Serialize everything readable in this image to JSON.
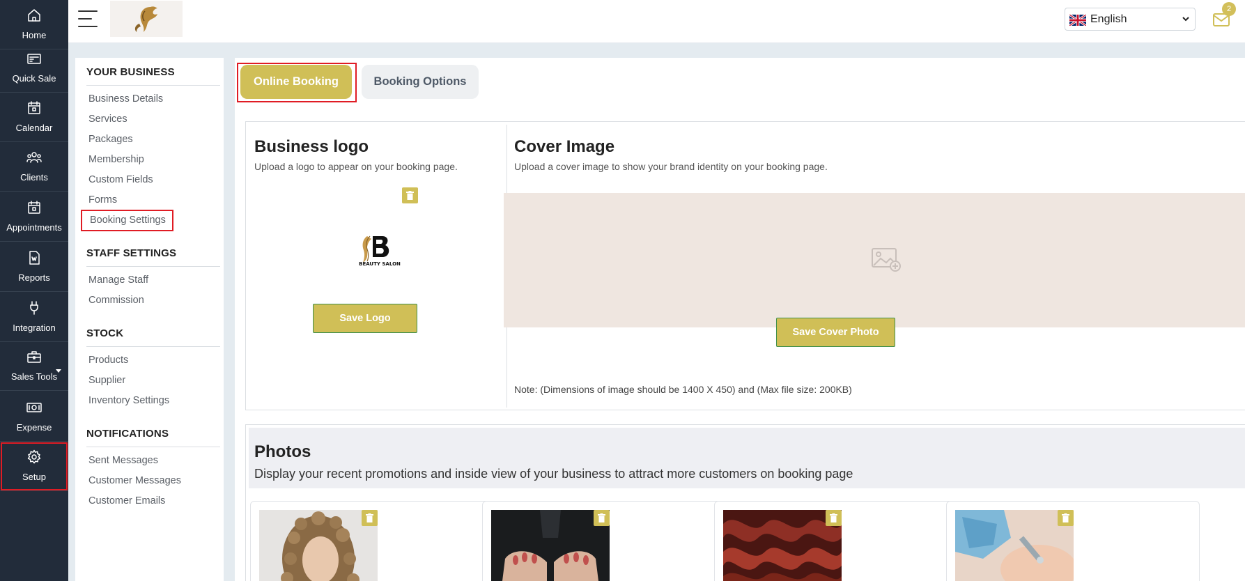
{
  "nav": {
    "items": [
      {
        "label": "Home",
        "icon": "home-icon"
      },
      {
        "label": "Quick Sale",
        "icon": "receipt-icon"
      },
      {
        "label": "Calendar",
        "icon": "calendar-icon"
      },
      {
        "label": "Clients",
        "icon": "users-icon"
      },
      {
        "label": "Appointments",
        "icon": "calendar-check-icon"
      },
      {
        "label": "Reports",
        "icon": "report-icon"
      },
      {
        "label": "Integration",
        "icon": "plug-icon"
      },
      {
        "label": "Sales Tools",
        "icon": "briefcase-icon"
      },
      {
        "label": "Expense",
        "icon": "cash-icon"
      },
      {
        "label": "Setup",
        "icon": "gear-icon"
      }
    ],
    "active": "Setup"
  },
  "topbar": {
    "language": "English",
    "mail_count": "2"
  },
  "settings_menu": {
    "your_business": "YOUR BUSINESS",
    "business_items": [
      "Business Details",
      "Services",
      "Packages",
      "Membership",
      "Custom Fields",
      "Forms",
      "Booking Settings"
    ],
    "staff_settings": "STAFF SETTINGS",
    "staff_items": [
      "Manage Staff",
      "Commission"
    ],
    "stock": "STOCK",
    "stock_items": [
      "Products",
      "Supplier",
      "Inventory Settings"
    ],
    "notifications": "NOTIFICATIONS",
    "notification_items": [
      "Sent Messages",
      "Customer Messages",
      "Customer Emails"
    ],
    "active": "Booking Settings"
  },
  "tabs": {
    "online_booking": "Online Booking",
    "booking_options": "Booking Options",
    "active": "Online Booking"
  },
  "logo_section": {
    "title": "Business logo",
    "description": "Upload a logo to appear on your booking page.",
    "logo_text": "BEAUTY SALON",
    "save_label": "Save Logo"
  },
  "cover_section": {
    "title": "Cover Image",
    "description": "Upload a cover image to show your brand identity on your booking page.",
    "save_label": "Save Cover Photo",
    "note": "Note: (Dimensions of image should be 1400 X 450) and (Max file size: 200KB)"
  },
  "photos_section": {
    "title": "Photos",
    "description": "Display your recent promotions and inside view of your business to attract more customers on booking page",
    "photos": [
      "curly-hair-woman",
      "manicured-hands",
      "wavy-red-hair",
      "facial-treatment"
    ]
  },
  "colors": {
    "accent_gold": "#d0bf57",
    "sidebar_bg": "#222c3a",
    "highlight_red": "#e01c24"
  }
}
